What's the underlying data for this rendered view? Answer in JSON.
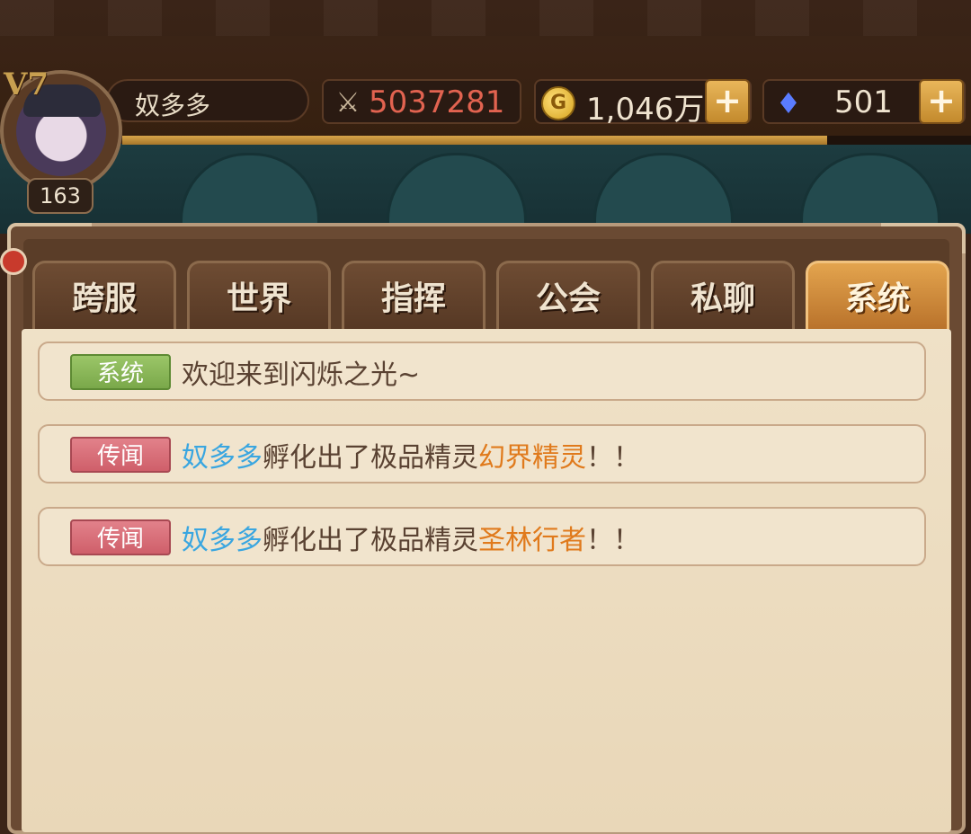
{
  "player": {
    "name": "奴多多",
    "vip": "V7",
    "level": "163",
    "exp_fraction": 0.83
  },
  "resources": {
    "power": "5037281",
    "gold": "1,046万",
    "gold_icon_letter": "G",
    "diamonds": "501",
    "plus_label": "+"
  },
  "chat": {
    "tabs": [
      {
        "label": "跨服",
        "active": false
      },
      {
        "label": "世界",
        "active": false
      },
      {
        "label": "指挥",
        "active": false
      },
      {
        "label": "公会",
        "active": false
      },
      {
        "label": "私聊",
        "active": false
      },
      {
        "label": "系统",
        "active": true
      }
    ],
    "messages": [
      {
        "tag": "系统",
        "text": "欢迎来到闪烁之光~"
      },
      {
        "tag": "传闻",
        "player": "奴多多",
        "middle": "孵化出了极品精灵",
        "item": "幻界精灵",
        "suffix": "！！"
      },
      {
        "tag": "传闻",
        "player": "奴多多",
        "middle": "孵化出了极品精灵",
        "item": "圣林行者",
        "suffix": "！！"
      }
    ]
  },
  "colors": {
    "player_name": "#3aa6e0",
    "item_name": "#e07a1c",
    "system_tag": "#7aa84a",
    "rumor_tag": "#cf5f6a",
    "active_tab": "#e3a44e"
  }
}
